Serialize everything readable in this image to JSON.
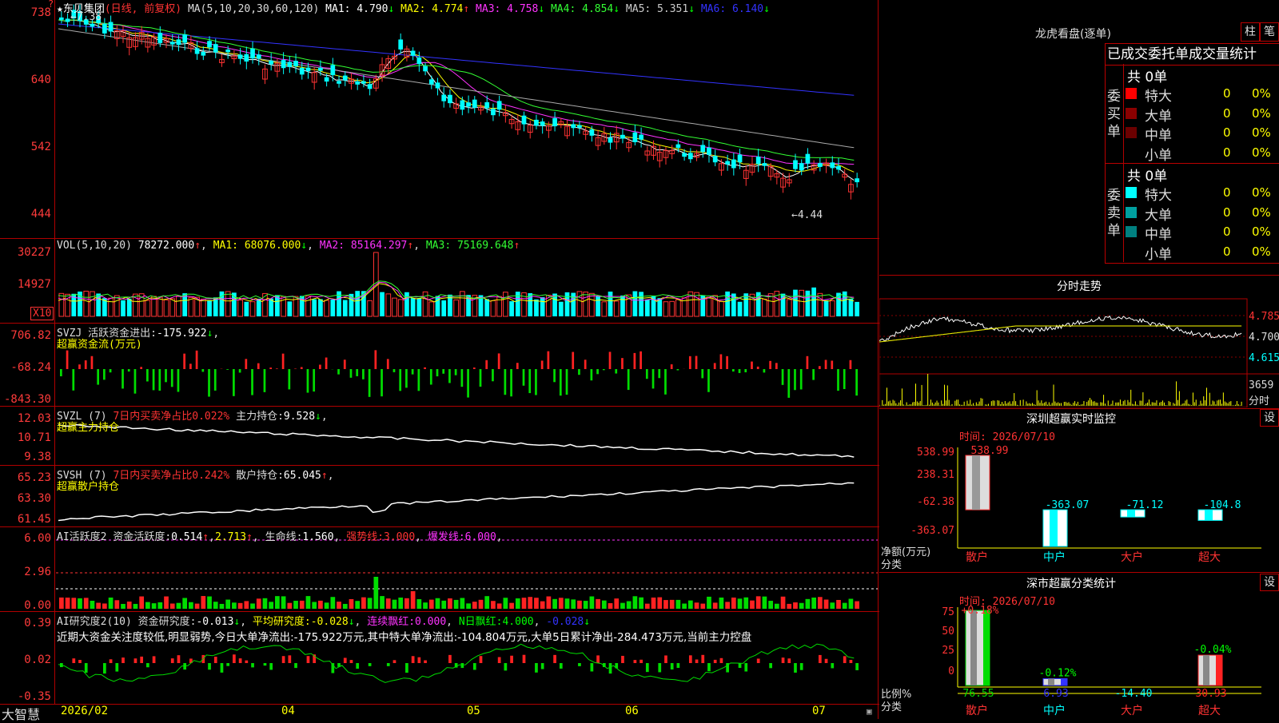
{
  "stock": {
    "title": "★东贝集团",
    "period": "(日线, 前复权)",
    "ma_label": "MA(5,10,20,30,60,120)",
    "ma": [
      {
        "label": "MA1:",
        "value": "4.790",
        "arrow": "↓",
        "color": "#ffffff"
      },
      {
        "label": "MA2:",
        "value": "4.774",
        "arrow": "↑",
        "color": "#ffff00"
      },
      {
        "label": "MA3:",
        "value": "4.758",
        "arrow": "↓",
        "color": "#ff33ff"
      },
      {
        "label": "MA4:",
        "value": "4.854",
        "arrow": "↓",
        "color": "#33ff33"
      },
      {
        "label": "MA5:",
        "value": "5.351",
        "arrow": "↓",
        "color": "#cccccc"
      },
      {
        "label": "MA6:",
        "value": "6.140",
        "arrow": "↓",
        "color": "#3333ff"
      }
    ],
    "price_axis": [
      "738",
      "640",
      "542",
      "444"
    ],
    "high_marker": "←7.38",
    "low_marker": "←4.44",
    "corner": "?"
  },
  "volume": {
    "label": "VOL(5,10,20)",
    "value": "78272.000",
    "ma1": "68076.000",
    "ma2": "85164.297",
    "ma3": "75169.648",
    "axis": [
      "30227",
      "14927"
    ],
    "unit": "X10"
  },
  "svzj": {
    "label": "SVZJ",
    "desc": "活跃资金进出:",
    "value": "-175.922",
    "subtitle": "超赢资金流(万元)",
    "axis": [
      "706.82",
      "-68.24",
      "-843.30"
    ]
  },
  "svzl": {
    "label": "SVZL (7)",
    "desc": "7日内买卖净占比0.022%",
    "hold_label": "主力持仓:",
    "hold": "9.528",
    "subtitle": "超赢主力持仓",
    "axis": [
      "12.03",
      "10.71",
      "9.38"
    ]
  },
  "svsh": {
    "label": "SVSH (7)",
    "desc": "7日内买卖净占比0.242%",
    "hold_label": "散户持仓:",
    "hold": "65.045",
    "subtitle": "超赢散户持仓",
    "axis": [
      "65.23",
      "63.30",
      "61.45"
    ]
  },
  "ai_active": {
    "label": "AI活跃度2",
    "f1": "资金活跃度:",
    "v1": "0.514",
    "v2": "2.713",
    "f3": "生命线:",
    "v3": "1.560",
    "f4": "强势线:",
    "v4": "3.000",
    "f5": "爆发线:",
    "v5": "6.000",
    "axis": [
      "6.00",
      "2.96",
      "0.00"
    ]
  },
  "ai_research": {
    "label": "AI研究度2(10)",
    "f1": "资金研究度:",
    "v1": "-0.013",
    "f2": "平均研究度:",
    "v2": "-0.028",
    "f3": "连续飘红:",
    "v3": "0.000",
    "f4": "N日飘红:",
    "v4": "4.000",
    "v5": "-0.028",
    "sentence": "近期大资金关注度较低,明显弱势,今日大单净流出:-175.922万元,其中特大单净流出:-104.804万元,大单5日累计净出-284.473万元,当前主力控盘",
    "axis": [
      "0.39",
      "0.02",
      "-0.35"
    ]
  },
  "date_axis": {
    "brand": "大智慧",
    "labels": [
      "2026/02",
      "04",
      "05",
      "06",
      "07"
    ]
  },
  "dragon": {
    "title": "龙虎看盘(逐单)",
    "btn1": "柱",
    "btn2": "笔",
    "tabs": "已成交委托单成交量统计",
    "buy_label": "委买单",
    "sell_label": "委卖单",
    "buy_total": "共 0单",
    "sell_total": "共 0单",
    "rows": [
      {
        "name": "特大",
        "count": "0",
        "pct": "0%"
      },
      {
        "name": "大单",
        "count": "0",
        "pct": "0%"
      },
      {
        "name": "中单",
        "count": "0",
        "pct": "0%"
      },
      {
        "name": "小单",
        "count": "0",
        "pct": "0%"
      }
    ]
  },
  "intraday": {
    "title": "分时走势",
    "price_labels": [
      "4.785",
      "4.700",
      "4.615"
    ],
    "vol_label": "3659",
    "vol_unit": "分时"
  },
  "sz_monitor": {
    "title": "深圳超赢实时监控",
    "setting": "设",
    "time": "时间: 2026/07/10",
    "axis": [
      "538.99",
      "238.31",
      "-62.38",
      "-363.07"
    ],
    "ylabel": "净额(万元)",
    "xlabel": "分类",
    "categories": [
      "散户",
      "中户",
      "大户",
      "超大"
    ],
    "values": [
      538.99,
      -363.07,
      -71.12,
      -104.8
    ],
    "value_labels": [
      "538.99",
      "-363.07",
      "-71.12",
      "-104.8"
    ]
  },
  "sz_category": {
    "title": "深市超赢分类统计",
    "setting": "设",
    "time": "时间: 2026/07/10",
    "axis": [
      "75",
      "50",
      "25",
      "0"
    ],
    "ylabel": "比例%",
    "xlabel": "分类",
    "categories": [
      "散户",
      "中户",
      "大户",
      "超大"
    ],
    "values": [
      76.55,
      6.93,
      -14.4,
      30.93
    ],
    "change_labels": [
      "+0.18%",
      "-0.12%",
      "",
      "-0.04%"
    ],
    "value_labels": [
      "76.55",
      "6.93",
      "-14.40",
      "30.93"
    ]
  },
  "colors": {
    "up": "#ff3333",
    "down": "#00ffff",
    "grid": "#b00000",
    "green": "#00dd00"
  }
}
